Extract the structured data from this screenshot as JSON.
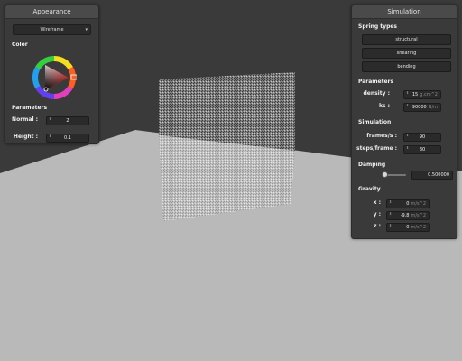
{
  "appearance": {
    "title": "Appearance",
    "mode_value": "Wireframe",
    "color_label": "Color",
    "parameters_label": "Parameters",
    "normal_label": "Normal :",
    "normal_value": "2",
    "height_label": "Height :",
    "height_value": "0.1",
    "selected_color": "#e02a2a"
  },
  "simulation": {
    "title": "Simulation",
    "spring_types_label": "Spring types",
    "spring_buttons": [
      "structural",
      "shearing",
      "bending"
    ],
    "parameters_label": "Parameters",
    "density_label": "density :",
    "density_value": "15",
    "density_unit": "g.cm^2",
    "ks_label": "ks :",
    "ks_value": "90000",
    "ks_unit": "N/m",
    "simulation_label": "Simulation",
    "frames_label": "frames/s :",
    "frames_value": "90",
    "steps_label": "steps/frame :",
    "steps_value": "30",
    "damping_label": "Damping",
    "damping_value": "0.500000",
    "damping_fraction": 0.05,
    "gravity_label": "Gravity",
    "x_label": "x :",
    "x_value": "0",
    "y_label": "y :",
    "y_value": "-9.8",
    "z_label": "z :",
    "z_value": "0",
    "gravity_unit": "m/s^2"
  },
  "colors": {
    "panel_bg": "#3a3a3a",
    "background_wall": "#3a3a3a",
    "floor": "#b9b9b9",
    "cloth": "#ffffff"
  }
}
